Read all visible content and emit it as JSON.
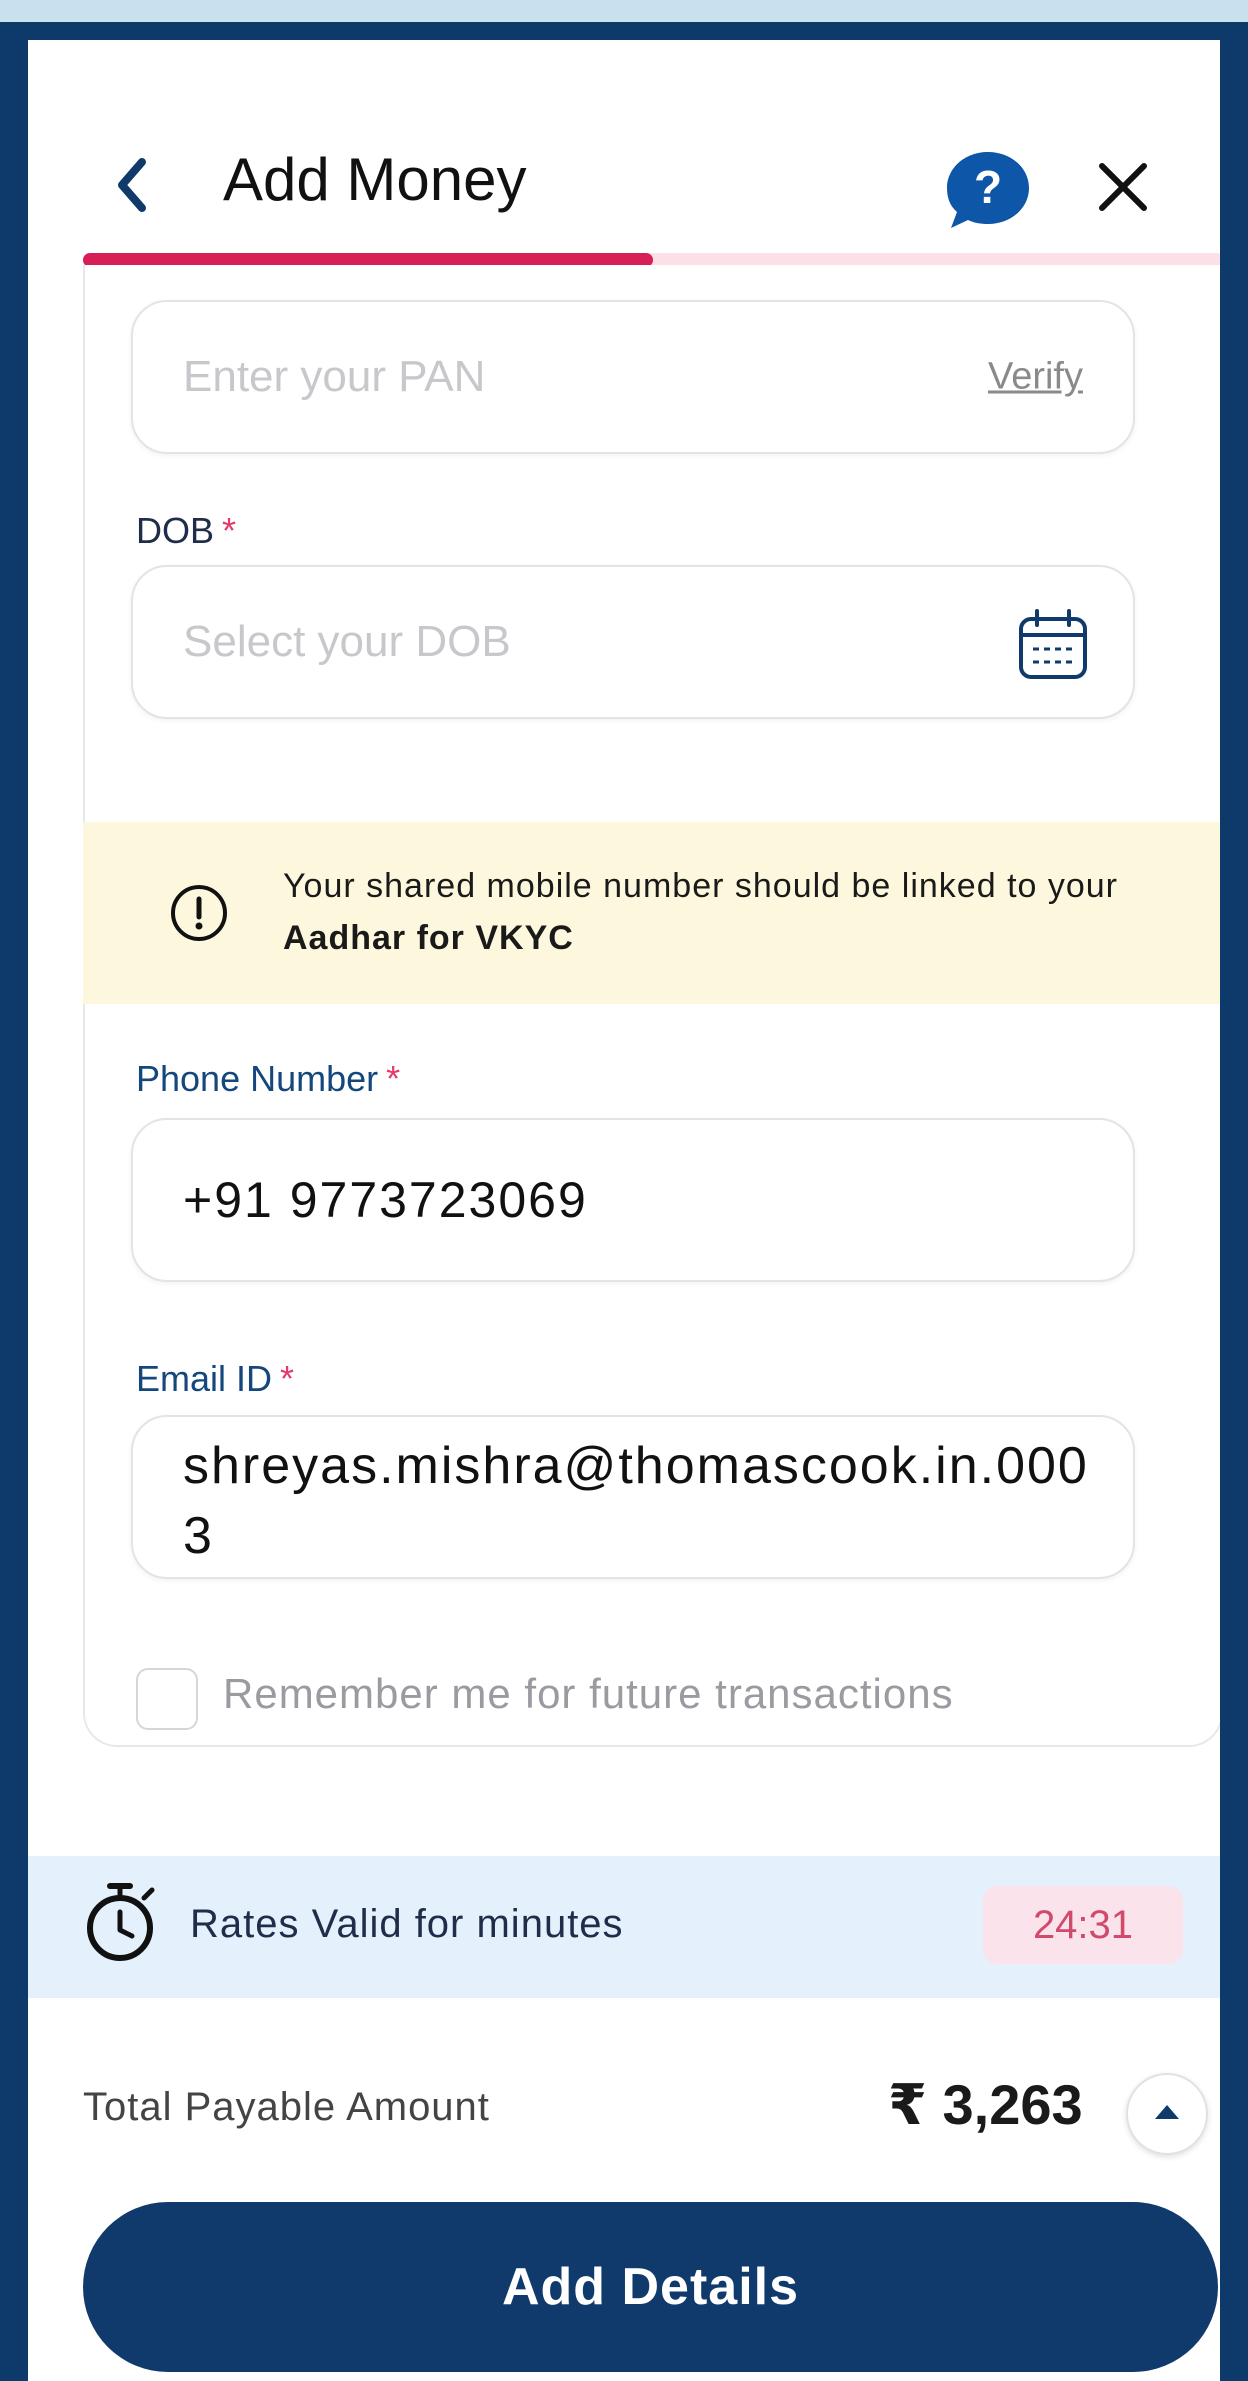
{
  "header": {
    "title": "Add Money",
    "help_icon_glyph": "?",
    "back_icon": "chevron-left-icon",
    "close_icon": "close-icon"
  },
  "progress": {
    "value": 0.5,
    "fill_color": "#d81e56",
    "track_color": "#fbe0e7"
  },
  "form": {
    "pan": {
      "placeholder": "Enter your PAN",
      "verify_label": "Verify"
    },
    "dob": {
      "label": "DOB",
      "required_mark": "*",
      "placeholder": "Select your DOB"
    },
    "info": {
      "text_prefix": "Your shared mobile number should be linked to your ",
      "text_bold": "Aadhar for VKYC"
    },
    "phone": {
      "label": "Phone Number",
      "required_mark": "*",
      "value": "+91 9773723069"
    },
    "email": {
      "label": "Email ID",
      "required_mark": "*",
      "value": "shreyas.mishra@thomascook.in.0003"
    },
    "remember": {
      "label": "Remember me for future transactions",
      "checked": false
    }
  },
  "rates": {
    "label": "Rates Valid for minutes",
    "timer": "24:31"
  },
  "total": {
    "label": "Total Payable Amount",
    "amount": "₹ 3,263"
  },
  "cta": {
    "label": "Add Details",
    "color": "#0f3a6b"
  }
}
